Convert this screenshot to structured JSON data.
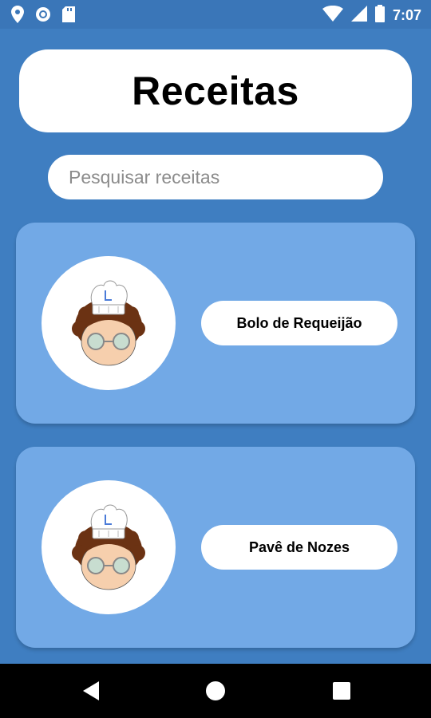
{
  "status_bar": {
    "time": "7:07",
    "icons": [
      "location-icon",
      "sync-icon",
      "sd-card-icon",
      "wifi-icon",
      "signal-icon",
      "battery-icon"
    ]
  },
  "header": {
    "title": "Receitas"
  },
  "search": {
    "placeholder": "Pesquisar receitas",
    "value": ""
  },
  "recipes": [
    {
      "name": "Bolo de Requeijão",
      "avatar": "chef-avatar-icon"
    },
    {
      "name": "Pavê de Nozes",
      "avatar": "chef-avatar-icon"
    }
  ],
  "nav": {
    "buttons": [
      "back-icon",
      "home-icon",
      "recents-icon"
    ]
  },
  "colors": {
    "background": "#3f7ec1",
    "status_bar": "#3a76b8",
    "card": "#72a9e6",
    "white": "#ffffff"
  }
}
